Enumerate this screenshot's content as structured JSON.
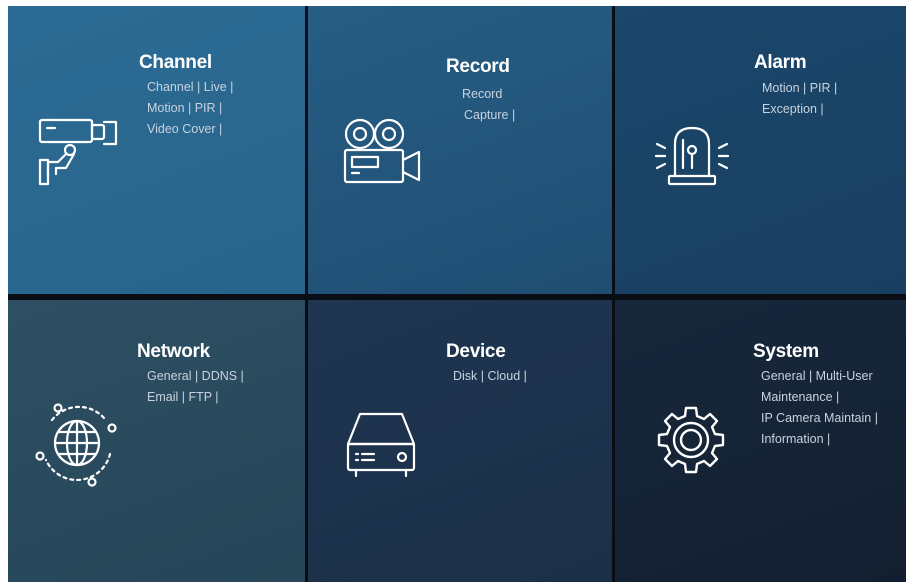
{
  "tiles": {
    "channel": {
      "title": "Channel",
      "lines": [
        "Channel | Live |",
        "Motion | PIR |",
        "Video Cover |"
      ],
      "icon": "cctv-camera-icon"
    },
    "record": {
      "title": "Record",
      "lines": [
        "Record",
        "Capture |"
      ],
      "icon": "video-camera-icon"
    },
    "alarm": {
      "title": "Alarm",
      "lines": [
        "Motion | PIR |",
        "Exception |"
      ],
      "icon": "alarm-beacon-icon"
    },
    "network": {
      "title": "Network",
      "lines": [
        "General | DDNS |",
        "Email | FTP |"
      ],
      "icon": "globe-icon"
    },
    "device": {
      "title": "Device",
      "lines": [
        "Disk | Cloud |"
      ],
      "icon": "dvr-device-icon"
    },
    "system": {
      "title": "System",
      "lines": [
        "General | Multi-User",
        "Maintenance |",
        "IP Camera Maintain |",
        "Information |"
      ],
      "icon": "gear-icon"
    }
  }
}
